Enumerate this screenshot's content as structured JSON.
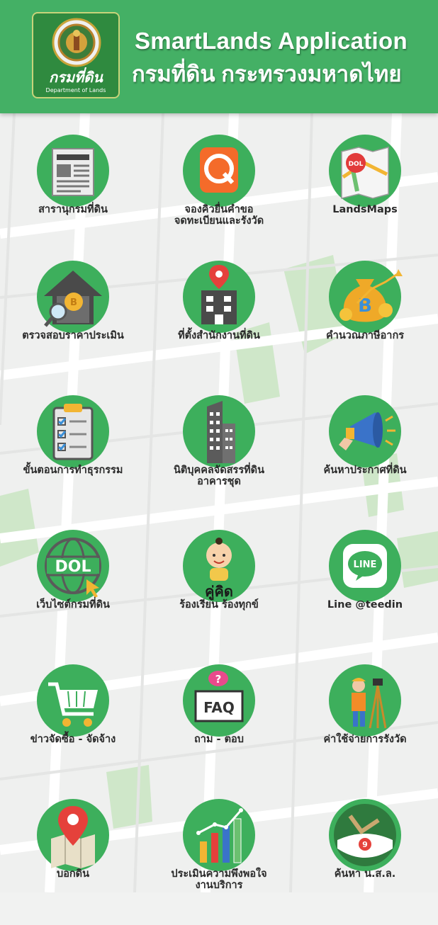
{
  "header": {
    "title_en": "SmartLands Application",
    "title_th": "กรมที่ดิน กระทรวงมหาดไทย",
    "logo_thai": "กรมที่ดิน",
    "logo_en": "Department of Lands",
    "bg_color": "#44b065"
  },
  "tiles": [
    {
      "label": "สารานุกรมที่ดิน",
      "label2": "",
      "icon": "newspaper-icon"
    },
    {
      "label": "จองคิวยื่นคำขอ",
      "label2": "จดทะเบียนและรังวัด",
      "icon": "queue-q-icon"
    },
    {
      "label": "LandsMaps",
      "label2": "",
      "icon": "map-icon"
    },
    {
      "label": "ตรวจสอบราคาประเมิน",
      "label2": "",
      "icon": "house-coin-magnifier-icon"
    },
    {
      "label": "ที่ตั้งสำนักงานที่ดิน",
      "label2": "",
      "icon": "building-pin-icon"
    },
    {
      "label": "คำนวณภาษีอากร",
      "label2": "",
      "icon": "money-bag-icon"
    },
    {
      "label": "ขั้นตอนการทำธุรกรรม",
      "label2": "",
      "icon": "clipboard-checklist-icon"
    },
    {
      "label": "นิติบุคคลจัดสรรที่ดิน",
      "label2": "อาคารชุด",
      "icon": "skyscraper-icon"
    },
    {
      "label": "ค้นหาประกาศที่ดิน",
      "label2": "",
      "icon": "megaphone-icon"
    },
    {
      "label": "เว็บไซต์กรมที่ดิน",
      "label2": "",
      "icon": "dol-globe-icon"
    },
    {
      "label": "ร้องเรียน ร้องทุกข์",
      "label2": "",
      "icon": "mascot-icon",
      "badge": "คู่คิด"
    },
    {
      "label": "Line @teedin",
      "label2": "",
      "icon": "line-app-icon",
      "badge": "LINE"
    },
    {
      "label": "ข่าวจัดซื้อ - จัดจ้าง",
      "label2": "",
      "icon": "shopping-cart-icon"
    },
    {
      "label": "ถาม - ตอบ",
      "label2": "",
      "icon": "faq-icon",
      "badge": "FAQ"
    },
    {
      "label": "ค่าใช้จ่ายการรังวัด",
      "label2": "",
      "icon": "surveyor-icon"
    },
    {
      "label": "บอกดิน",
      "label2": "",
      "icon": "map-pin-icon"
    },
    {
      "label": "ประเมินความพึงพอใจ",
      "label2": "งานบริการ",
      "icon": "bar-chart-icon"
    },
    {
      "label": "ค้นหา น.ส.ล.",
      "label2": "",
      "icon": "land-search-icon"
    }
  ]
}
